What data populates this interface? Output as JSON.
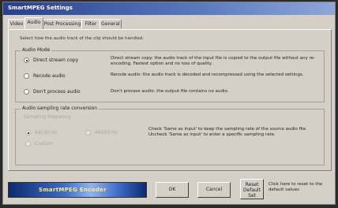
{
  "window": {
    "title": "SmartMPEG Settings"
  },
  "tabs": [
    {
      "label": "Video",
      "active": false
    },
    {
      "label": "Audio",
      "active": true
    },
    {
      "label": "Post Processing",
      "active": false
    },
    {
      "label": "Filter",
      "active": false
    },
    {
      "label": "General",
      "active": false
    }
  ],
  "audio": {
    "intro": "Select how the audio track of the clip should be handled.",
    "mode_group": "Audio Mode",
    "modes": [
      {
        "label": "Direct stream copy",
        "selected": true,
        "desc": "Direct stream copy: the audio track of the input file is copied to the output file without any re-encoding. Fastest option and no loss of quality."
      },
      {
        "label": "Recode audio",
        "selected": false,
        "desc": "Recode audio: the audio track is decoded and recompressed using the selected settings."
      },
      {
        "label": "Don't process audio",
        "selected": false,
        "desc": "Don't process audio: the output file contains no audio."
      }
    ],
    "sampling_group": "Audio sampling rate conversion",
    "sampling_freq_label": "Sampling frequency",
    "sampling_opts": [
      {
        "label": "44100 Hz",
        "selected": true
      },
      {
        "label": "48000 Hz",
        "selected": false
      },
      {
        "label": "Custom",
        "selected": false
      }
    ],
    "sampling_desc": "Check 'Same as input' to keep the sampling rate of the source audio file. Uncheck 'Same as input' to enter a specific sampling rate."
  },
  "footer": {
    "banner_text": "SmartMPEG Encoder",
    "ok": "OK",
    "cancel": "Cancel",
    "reset_label": "Reset Default Set",
    "reset_hint": "Click here to reset to the default values"
  },
  "colors": {
    "dialog_face": "#d4d0c8",
    "titlebar": "#2a3e8e",
    "banner": "#3d6bc6",
    "banner_text": "#ffe97a"
  }
}
